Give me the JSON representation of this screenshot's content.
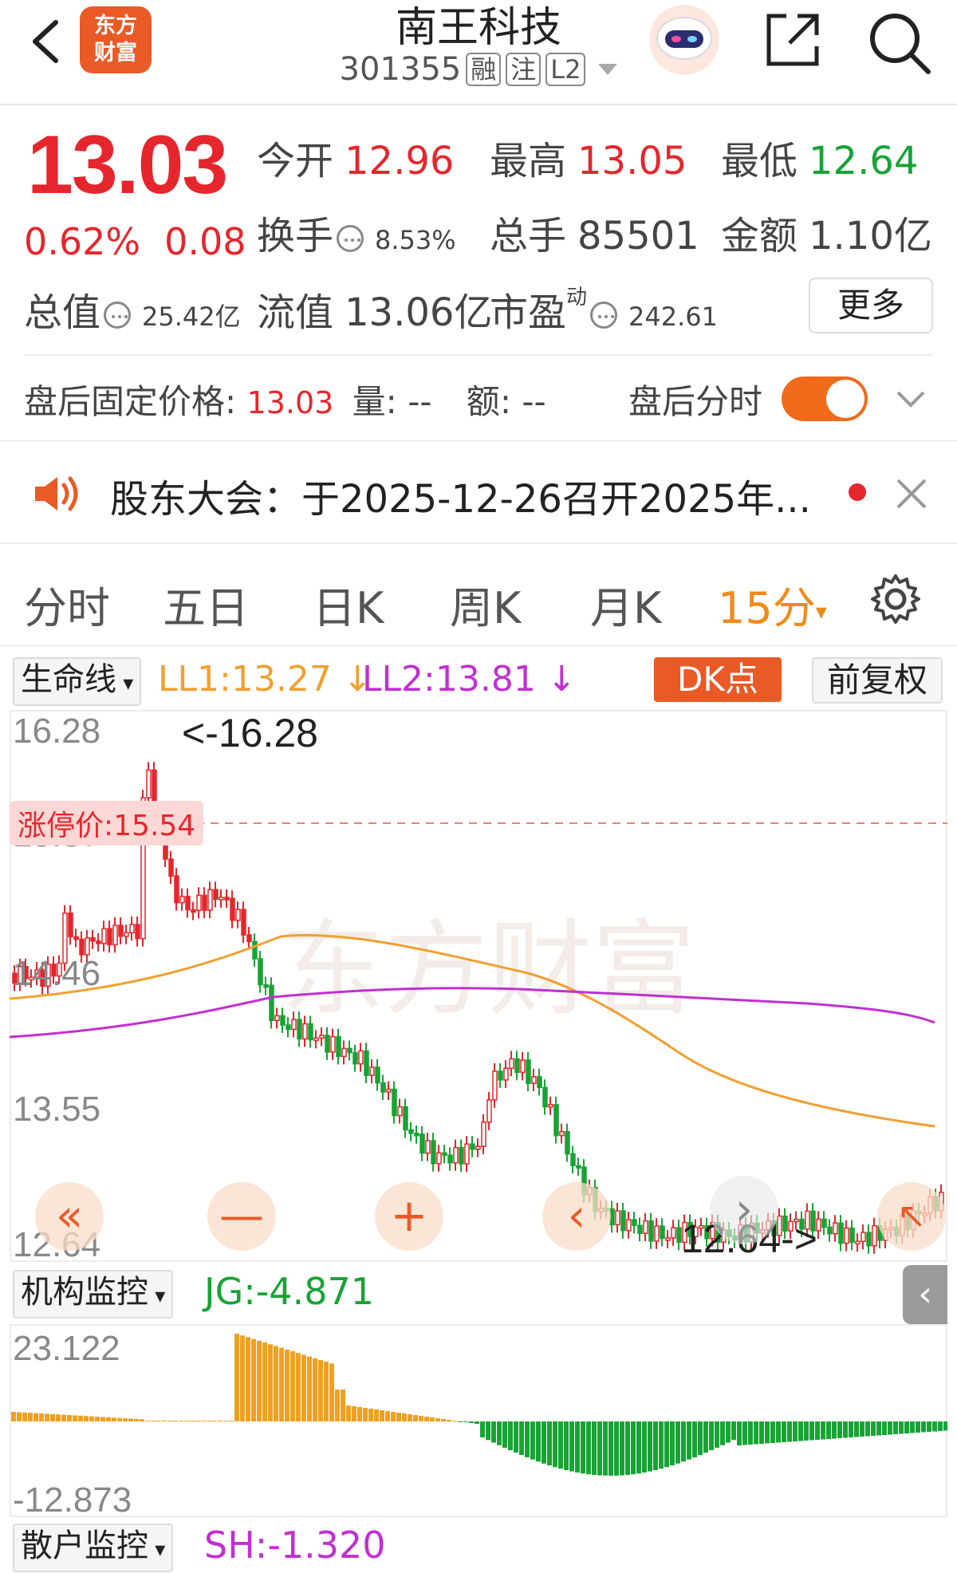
{
  "header": {
    "logo_text_line1": "东方",
    "logo_text_line2": "财富",
    "stock_name": "南王科技",
    "stock_code": "301355",
    "tags": [
      "融",
      "注",
      "L2"
    ]
  },
  "quote": {
    "price": "13.03",
    "change_pct": "0.62%",
    "change_amt": "0.08",
    "open_label": "今开",
    "open": "12.96",
    "high_label": "最高",
    "high": "13.05",
    "low_label": "最低",
    "low": "12.64",
    "turnover_label": "换手",
    "turnover": "8.53%",
    "volume_label": "总手",
    "volume": "85501",
    "amount_label": "金额",
    "amount": "1.10亿",
    "mktcap_label": "总值",
    "mktcap": "25.42亿",
    "float_label": "流值",
    "float": "13.06亿",
    "pe_label": "市盈",
    "pe_sup": "动",
    "pe": "242.61",
    "more_button": "更多"
  },
  "after_hours": {
    "price_label": "盘后固定价格:",
    "price": "13.03",
    "vol_label": "量:",
    "vol": "--",
    "amt_label": "额:",
    "amt": "--",
    "toggle_label": "盘后分时",
    "toggle_on": true
  },
  "notice": {
    "text": "股东大会：于2025-12-26召开2025年..."
  },
  "tabs": {
    "items": [
      "分时",
      "五日",
      "日K",
      "周K",
      "月K",
      "15分"
    ],
    "active": "15分"
  },
  "indicator": {
    "name": "生命线",
    "ll1": "LL1:13.27",
    "ll1_arrow": "↓",
    "ll2": "LL2:13.81",
    "ll2_arrow": "↓",
    "dk_button": "DK点",
    "fq_button": "前复权"
  },
  "main_chart": {
    "y_labels": [
      "16.28",
      "15.37",
      "14.46",
      "13.55",
      "12.64"
    ],
    "limit_up_label": "涨停价:15.54",
    "high_annotation": "<-16.28",
    "low_annotation": "12.64->",
    "nav_buttons": [
      "«",
      "—",
      "+",
      "‹",
      "›",
      "↖"
    ],
    "colors": {
      "up": "#e5262c",
      "down": "#18a335",
      "ll1": "#f0a030",
      "ll2": "#c030d0"
    }
  },
  "sub_chart": {
    "name": "机构监控",
    "jg": "JG:-4.871",
    "max_label": "23.122",
    "min_label": "-12.873",
    "name2": "散户监控",
    "sh": "SH:-1.320"
  },
  "watermark": "东方财富"
}
